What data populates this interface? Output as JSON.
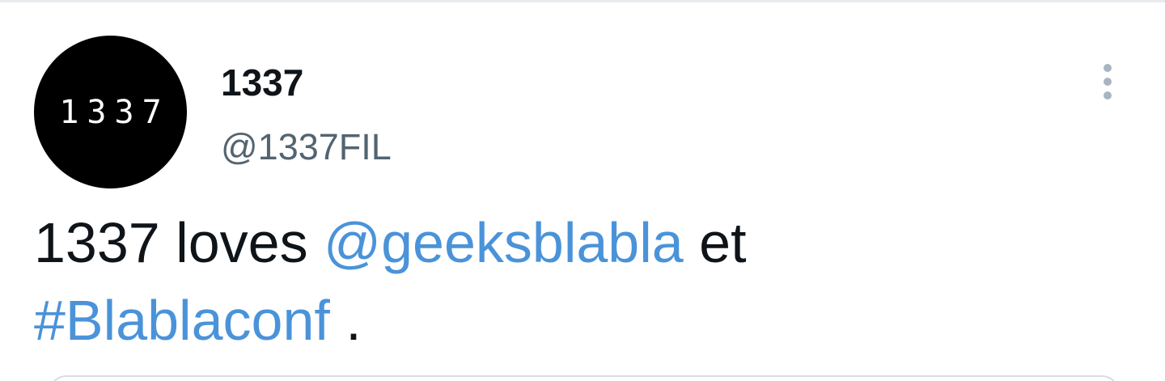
{
  "tweet": {
    "avatar_text": "1337",
    "display_name": "1337",
    "handle": "@1337FIL",
    "body": {
      "part1": "1337 loves ",
      "mention": "@geeksblabla",
      "part2": " et",
      "hashtag": "#Blablaconf",
      "part3": " ."
    },
    "more_icon": "more-vertical-icon",
    "colors": {
      "text": "#0f1419",
      "secondary": "#536471",
      "link": "#4a93d9",
      "avatar_bg": "#000000"
    }
  }
}
